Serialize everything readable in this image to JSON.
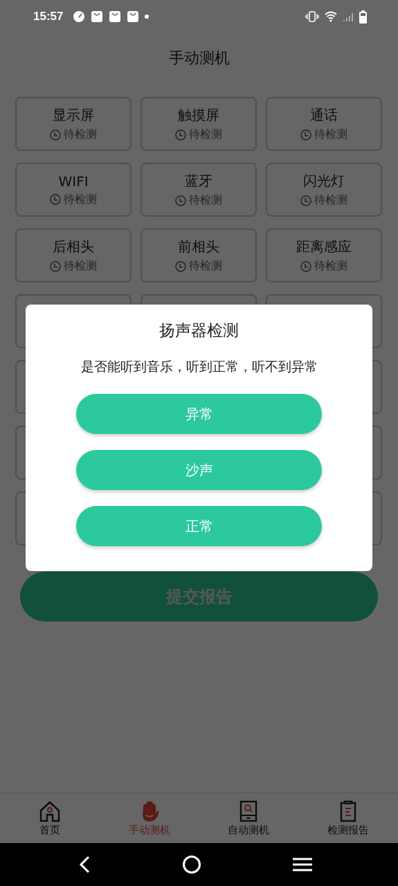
{
  "status_bar": {
    "time": "15:57"
  },
  "header": {
    "title": "手动测机"
  },
  "cards": [
    {
      "name": "显示屏",
      "status": "待检测"
    },
    {
      "name": "触摸屏",
      "status": "待检测"
    },
    {
      "name": "通话",
      "status": "待检测"
    },
    {
      "name": "WIFI",
      "status": "待检测"
    },
    {
      "name": "蓝牙",
      "status": "待检测"
    },
    {
      "name": "闪光灯",
      "status": "待检测"
    },
    {
      "name": "后相头",
      "status": "待检测"
    },
    {
      "name": "前相头",
      "status": "待检测"
    },
    {
      "name": "距离感应",
      "status": "待检测"
    }
  ],
  "submit_button": {
    "label": "提交报告"
  },
  "dialog": {
    "title": "扬声器检测",
    "message": "是否能听到音乐，听到正常，听不到异常",
    "buttons": [
      "异常",
      "沙声",
      "正常"
    ]
  },
  "tab_bar": [
    {
      "label": "首页",
      "selected": false
    },
    {
      "label": "手动测机",
      "selected": true
    },
    {
      "label": "自动测机",
      "selected": false
    },
    {
      "label": "检测报告",
      "selected": false
    }
  ]
}
